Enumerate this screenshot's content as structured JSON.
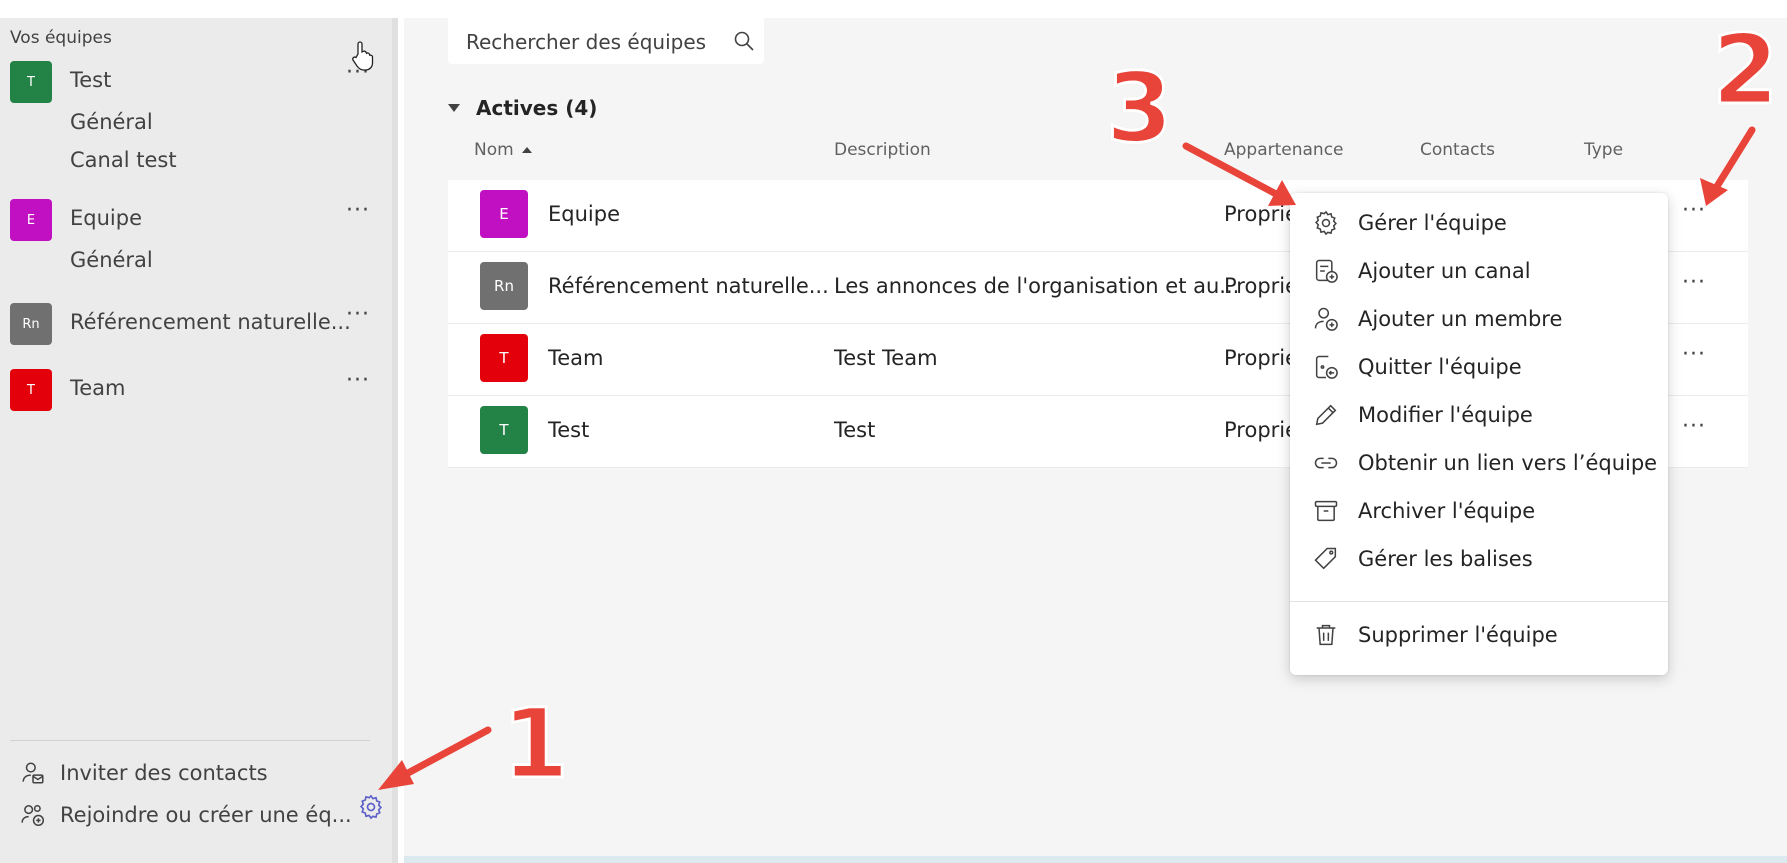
{
  "colors": {
    "green": "#238347",
    "magenta": "#c10fc2",
    "gray": "#707070",
    "red": "#e3000b",
    "annotation": "#e8443a"
  },
  "sidebar": {
    "title": "Vos équipes",
    "teams": [
      {
        "initials": "T",
        "name": "Test",
        "channels": [
          "Général",
          "Canal test"
        ]
      },
      {
        "initials": "E",
        "name": "Equipe",
        "channels": [
          "Général"
        ]
      },
      {
        "initials": "Rn",
        "name": "Référencement naturelle...",
        "channels": []
      },
      {
        "initials": "T",
        "name": "Team",
        "channels": []
      }
    ],
    "more_label": "···",
    "invite_label": "Inviter des contacts",
    "join_label": "Rejoindre ou créer une éq..."
  },
  "main": {
    "search_placeholder": "Rechercher des équipes",
    "section_title": "Actives (4)",
    "columns": {
      "name": "Nom",
      "description": "Description",
      "membership": "Appartenance",
      "contacts": "Contacts",
      "type": "Type"
    },
    "rows": [
      {
        "initials": "E",
        "name": "Equipe",
        "description": "",
        "membership": "Proprié"
      },
      {
        "initials": "Rn",
        "name": "Référencement naturelle...",
        "description": "Les annonces de l'organisation et au...",
        "membership": "Proprié"
      },
      {
        "initials": "T",
        "name": "Team",
        "description": "Test Team",
        "membership": "Proprié"
      },
      {
        "initials": "T",
        "name": "Test",
        "description": "Test",
        "membership": "Proprié"
      }
    ],
    "more_label": "···"
  },
  "menu": {
    "items": [
      {
        "label": "Gérer l'équipe",
        "icon": "gear-icon"
      },
      {
        "label": "Ajouter un canal",
        "icon": "add-channel-icon"
      },
      {
        "label": "Ajouter un membre",
        "icon": "add-member-icon"
      },
      {
        "label": "Quitter l'équipe",
        "icon": "leave-icon"
      },
      {
        "label": "Modifier l'équipe",
        "icon": "pencil-icon"
      },
      {
        "label": "Obtenir un lien vers l’équipe",
        "icon": "link-icon"
      },
      {
        "label": "Archiver l'équipe",
        "icon": "archive-icon"
      },
      {
        "label": "Gérer les balises",
        "icon": "tag-icon"
      }
    ],
    "delete_label": "Supprimer l'équipe"
  },
  "annotations": [
    "1",
    "2",
    "3"
  ]
}
